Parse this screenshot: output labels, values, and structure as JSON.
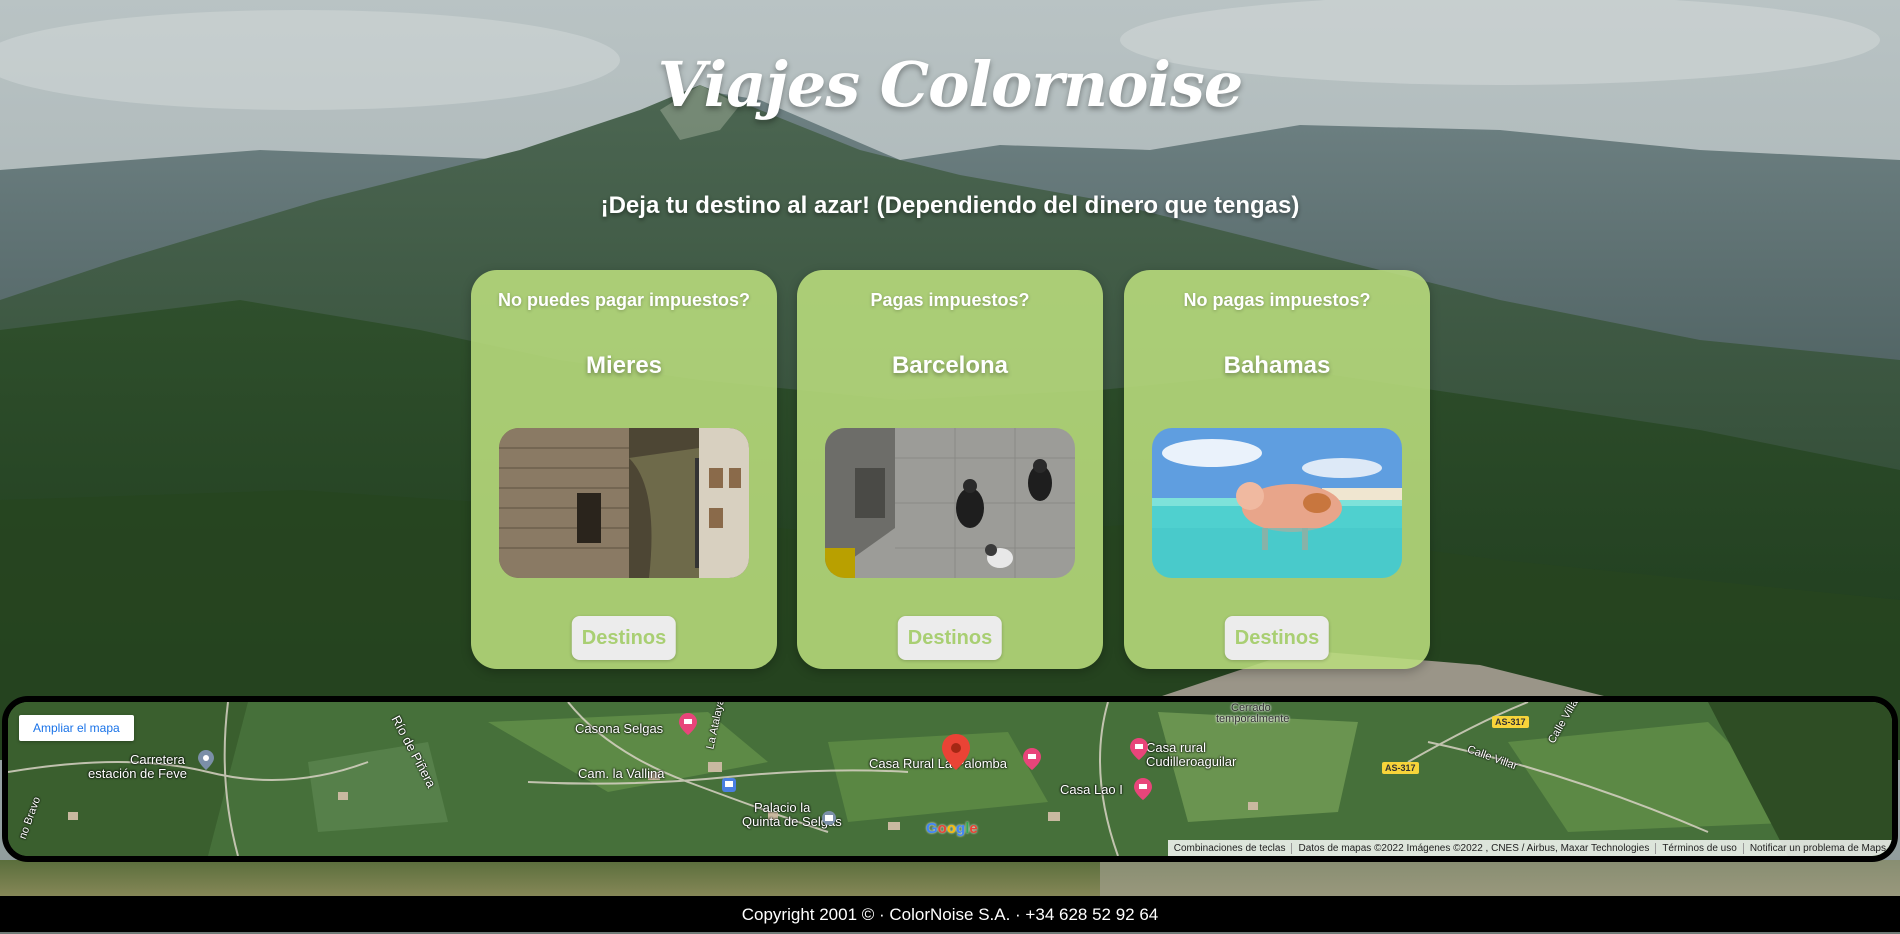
{
  "header": {
    "title": "Viajes Colornoise",
    "subtitle": "¡Deja tu destino al azar! (Dependiendo del dinero que tengas)"
  },
  "cards": [
    {
      "question": "No puedes pagar impuestos?",
      "city": "Mieres",
      "button": "Destinos"
    },
    {
      "question": "Pagas impuestos?",
      "city": "Barcelona",
      "button": "Destinos"
    },
    {
      "question": "No pagas impuestos?",
      "city": "Bahamas",
      "button": "Destinos"
    }
  ],
  "map": {
    "expand_button": "Ampliar el mapa",
    "labels": {
      "casona": "Casona Selgas",
      "carretera_1": "Carretera",
      "carretera_2": "estación de Feve",
      "rio": "Río de Piñera",
      "atalaya": "La Atalaya",
      "cam_vallina": "Cam. la Vallina",
      "palacio_1": "Palacio la",
      "palacio_2": "Quinta de Selgas",
      "bravo": "no Bravo",
      "palomba": "Casa Rural La Palomba",
      "cerrado_1": "Cerrado",
      "cerrado_2": "temporalmente",
      "cudillero_1": "Casa rural",
      "cudillero_2": "Cudilleroaguilar",
      "lao": "Casa Lao I",
      "calle_villar_1": "Calle Villar",
      "calle_villar_2": "Calle Villar"
    },
    "road_badges": [
      "AS-317",
      "AS-317"
    ],
    "google_logo": "Google",
    "attribution": [
      "Combinaciones de teclas",
      "Datos de mapas ©2022 Imágenes ©2022 , CNES / Airbus, Maxar Technologies",
      "Términos de uso",
      "Notificar un problema de Maps"
    ]
  },
  "footer": {
    "text": "Copyright 2001 © · ColorNoise S.A. · +34 628 52 92 64"
  },
  "colors": {
    "card": "#badd7d",
    "button_text": "#a9cf73",
    "button_bg": "#ececec",
    "footer_bg": "#000000",
    "map_link": "#1a73e8",
    "pin": "#ea4335"
  },
  "icons": {
    "map_pin": "map-pin-icon",
    "hotel": "hotel-pin-icon",
    "bus": "bus-stop-icon",
    "place": "place-pin-icon"
  }
}
